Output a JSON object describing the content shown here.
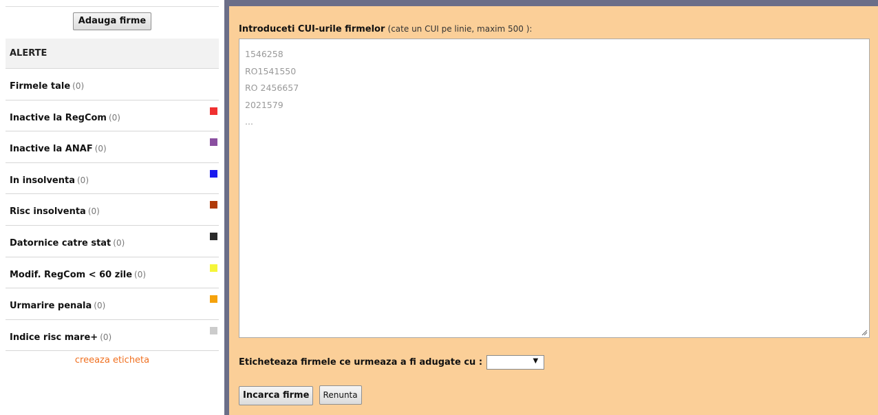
{
  "sidebar": {
    "add_button": "Adauga firme",
    "header": "ALERTE",
    "items": [
      {
        "label": "Firmele tale",
        "count": "(0)",
        "color": ""
      },
      {
        "label": "Inactive la RegCom",
        "count": "(0)",
        "color": "#f03030"
      },
      {
        "label": "Inactive la ANAF",
        "count": "(0)",
        "color": "#8a4fa0"
      },
      {
        "label": "In insolventa",
        "count": "(0)",
        "color": "#1a1aee"
      },
      {
        "label": "Risc insolventa",
        "count": "(0)",
        "color": "#b03a08"
      },
      {
        "label": "Datornice catre stat",
        "count": "(0)",
        "color": "#2a2a2a"
      },
      {
        "label": "Modif. RegCom < 60 zile",
        "count": "(0)",
        "color": "#f5f53a"
      },
      {
        "label": "Urmarire penala",
        "count": "(0)",
        "color": "#f5a20c"
      },
      {
        "label": "Indice risc mare+",
        "count": "(0)",
        "color": "#cccccc"
      }
    ],
    "create_tag_link": "creeaza eticheta"
  },
  "main": {
    "instruction_bold": "Introduceti CUI-urile firmelor",
    "instruction_hint": "(cate un CUI pe linie, maxim 500 ):",
    "textarea_placeholder": [
      "1546258",
      "RO1541550",
      "RO 2456657",
      "2021579",
      "..."
    ],
    "label_prompt": "Eticheteaza firmele ce urmeaza a fi adugate cu :",
    "tag_select_value": "",
    "submit_button": "Incarca firme",
    "cancel_button": "Renunta"
  },
  "colors": {
    "panel_bg": "#fbcf98",
    "separator": "#6b6e88",
    "link": "#f07020"
  }
}
